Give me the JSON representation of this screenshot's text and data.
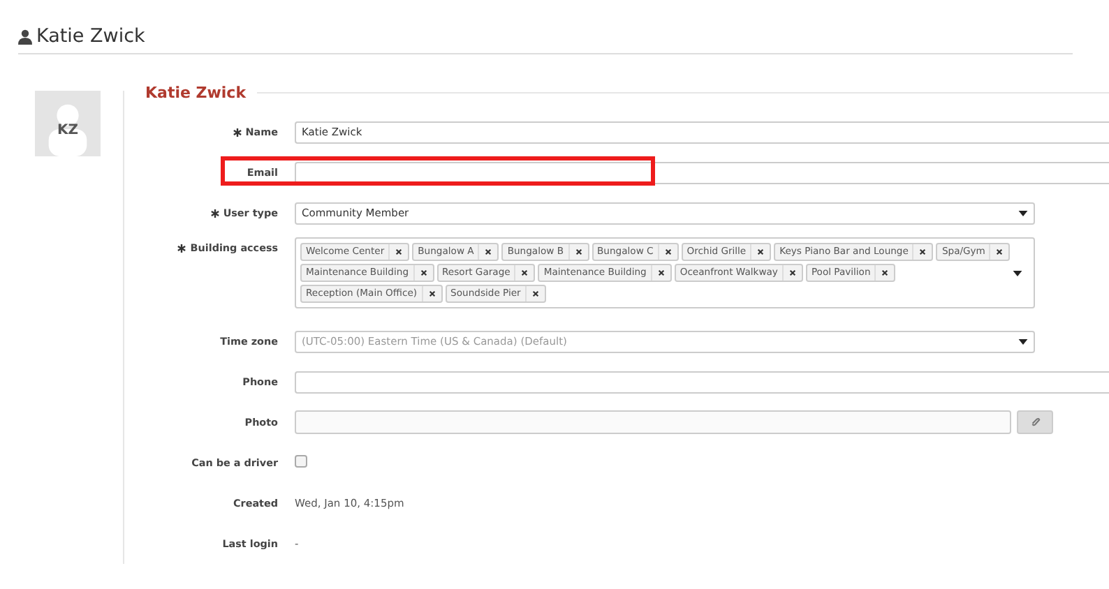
{
  "header": {
    "title": "Katie Zwick"
  },
  "avatar": {
    "initials": "KZ"
  },
  "section": {
    "title": "Katie Zwick"
  },
  "fields": [
    {
      "kind": "text",
      "label": "Name",
      "required": true,
      "value": "Katie Zwick",
      "highlighted": false
    },
    {
      "kind": "text",
      "label": "Email",
      "required": false,
      "highlighted": true
    },
    {
      "kind": "select",
      "label": "User type",
      "required": true,
      "value": "Community Member",
      "highlighted": false
    },
    {
      "kind": "tags",
      "label": "Building access",
      "required": true,
      "tags": [
        "Welcome Center",
        "Bungalow A",
        "Bungalow B",
        "Bungalow C",
        "Orchid Grille",
        "Keys Piano Bar and Lounge",
        "Spa/Gym",
        "Maintenance Building",
        "Resort Garage",
        "Maintenance Building",
        "Oceanfront Walkway",
        "Pool Pavilion",
        "Reception (Main Office)",
        "Soundside Pier"
      ],
      "highlighted": false
    },
    {
      "kind": "select",
      "label": "Time zone",
      "required": false,
      "placeholder": "(UTC-05:00) Eastern Time (US & Canada) (Default)",
      "highlighted": false
    },
    {
      "kind": "text",
      "label": "Phone",
      "required": false,
      "highlighted": false
    },
    {
      "kind": "file",
      "label": "Photo",
      "required": false,
      "highlighted": false
    },
    {
      "kind": "checkbox",
      "label": "Can be a driver",
      "required": false,
      "checked": false,
      "highlighted": false
    },
    {
      "kind": "static",
      "label": "Created",
      "required": false,
      "value": "Wed, Jan 10, 4:15pm",
      "highlighted": false
    },
    {
      "kind": "static",
      "label": "Last login",
      "required": false,
      "value": "-",
      "highlighted": false
    }
  ]
}
